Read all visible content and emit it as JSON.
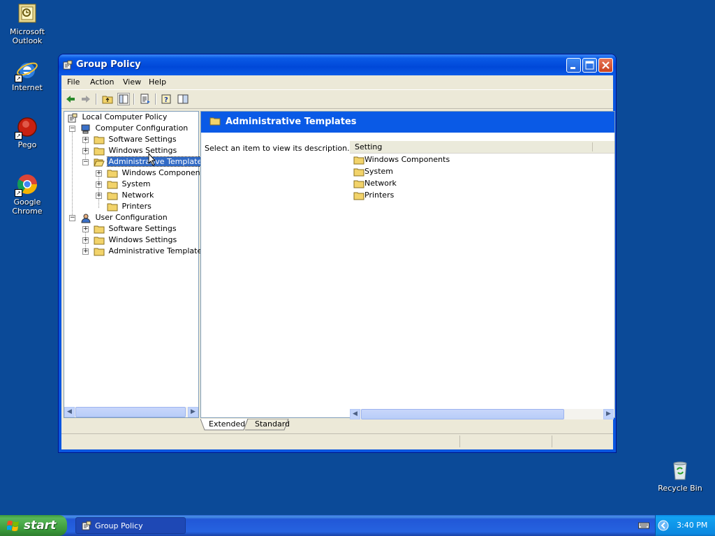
{
  "desktop": {
    "icons": [
      {
        "label": "Microsoft Outlook",
        "icon": "outlook-icon"
      },
      {
        "label": "Internet",
        "icon": "internet-explorer-icon"
      },
      {
        "label": "Pego",
        "icon": "pego-icon"
      },
      {
        "label": "Google Chrome",
        "icon": "chrome-icon"
      },
      {
        "label": "Recycle Bin",
        "icon": "recycle-bin-icon"
      }
    ]
  },
  "window": {
    "title": "Group Policy",
    "menu": [
      "File",
      "Action",
      "View",
      "Help"
    ],
    "tree": {
      "root": "Local Computer Policy",
      "computer_config": "Computer Configuration",
      "cc_software": "Software Settings",
      "cc_windows": "Windows Settings",
      "cc_admin": "Administrative Templates",
      "cc_admin_children": [
        "Windows Components",
        "System",
        "Network",
        "Printers"
      ],
      "user_config": "User Configuration",
      "uc_software": "Software Settings",
      "uc_windows": "Windows Settings",
      "uc_admin": "Administrative Templates"
    },
    "right_pane": {
      "header": "Administrative Templates",
      "description": "Select an item to view its description.",
      "column": "Setting",
      "items": [
        "Windows Components",
        "System",
        "Network",
        "Printers"
      ]
    },
    "tabs": [
      "Extended",
      "Standard"
    ]
  },
  "taskbar": {
    "start": "start",
    "task": "Group Policy",
    "clock": "3:40 PM"
  }
}
